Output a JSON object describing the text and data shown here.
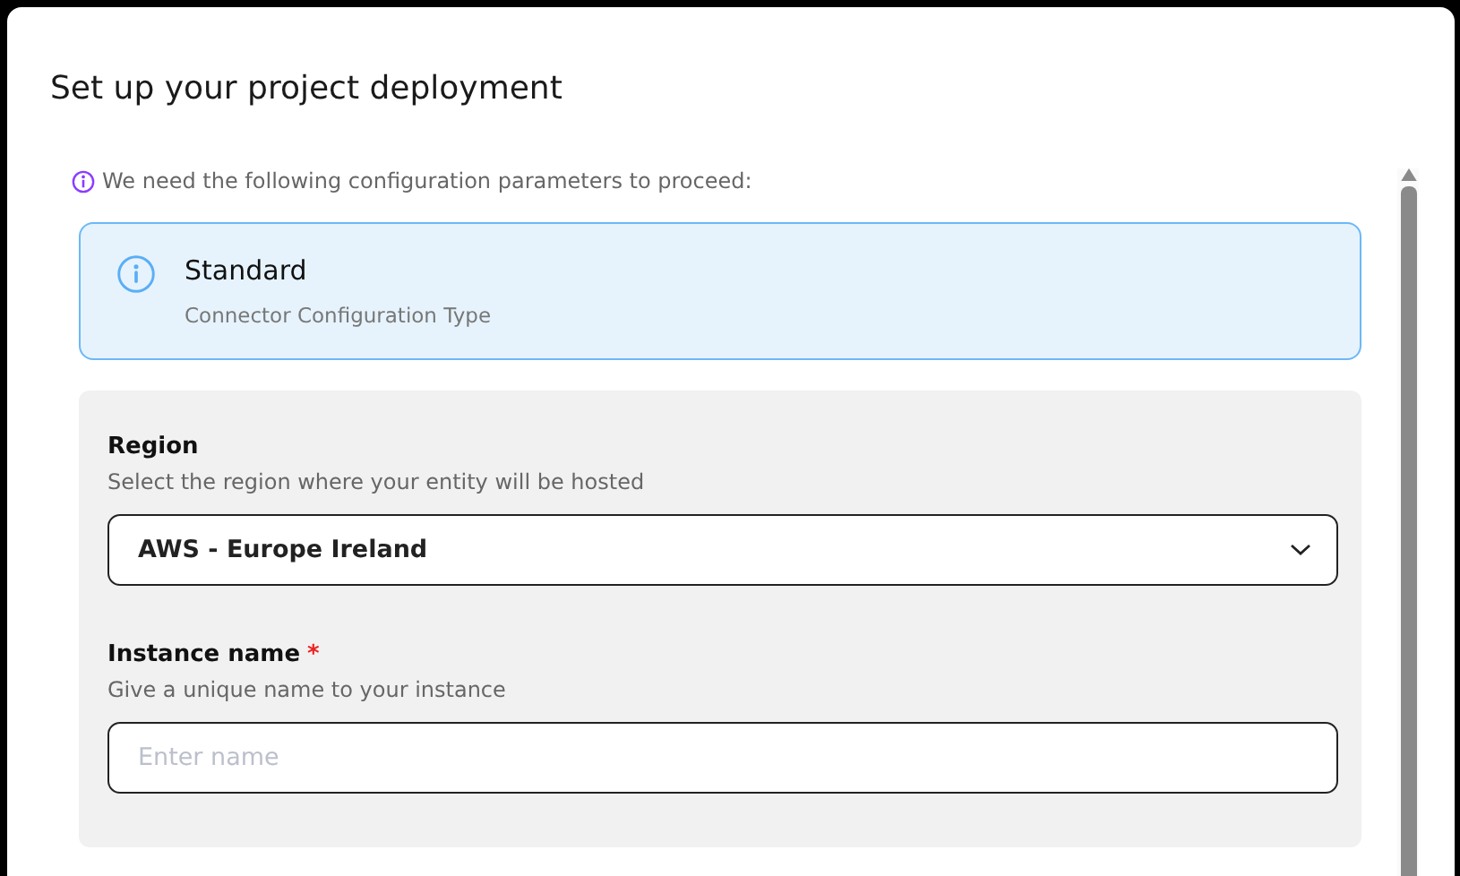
{
  "dialog": {
    "title": "Set up your project deployment"
  },
  "notice": "We need the following configuration parameters to proceed:",
  "config_card": {
    "title": "Standard",
    "subtitle": "Connector Configuration Type"
  },
  "fields": [
    {
      "kind": "select",
      "label": "Region",
      "help": "Select the region where your entity will be hosted",
      "value": "AWS - Europe Ireland"
    },
    {
      "kind": "text",
      "label": "Instance name",
      "required_mark": "*",
      "help": "Give a unique name to your instance",
      "placeholder": "Enter name"
    }
  ]
}
